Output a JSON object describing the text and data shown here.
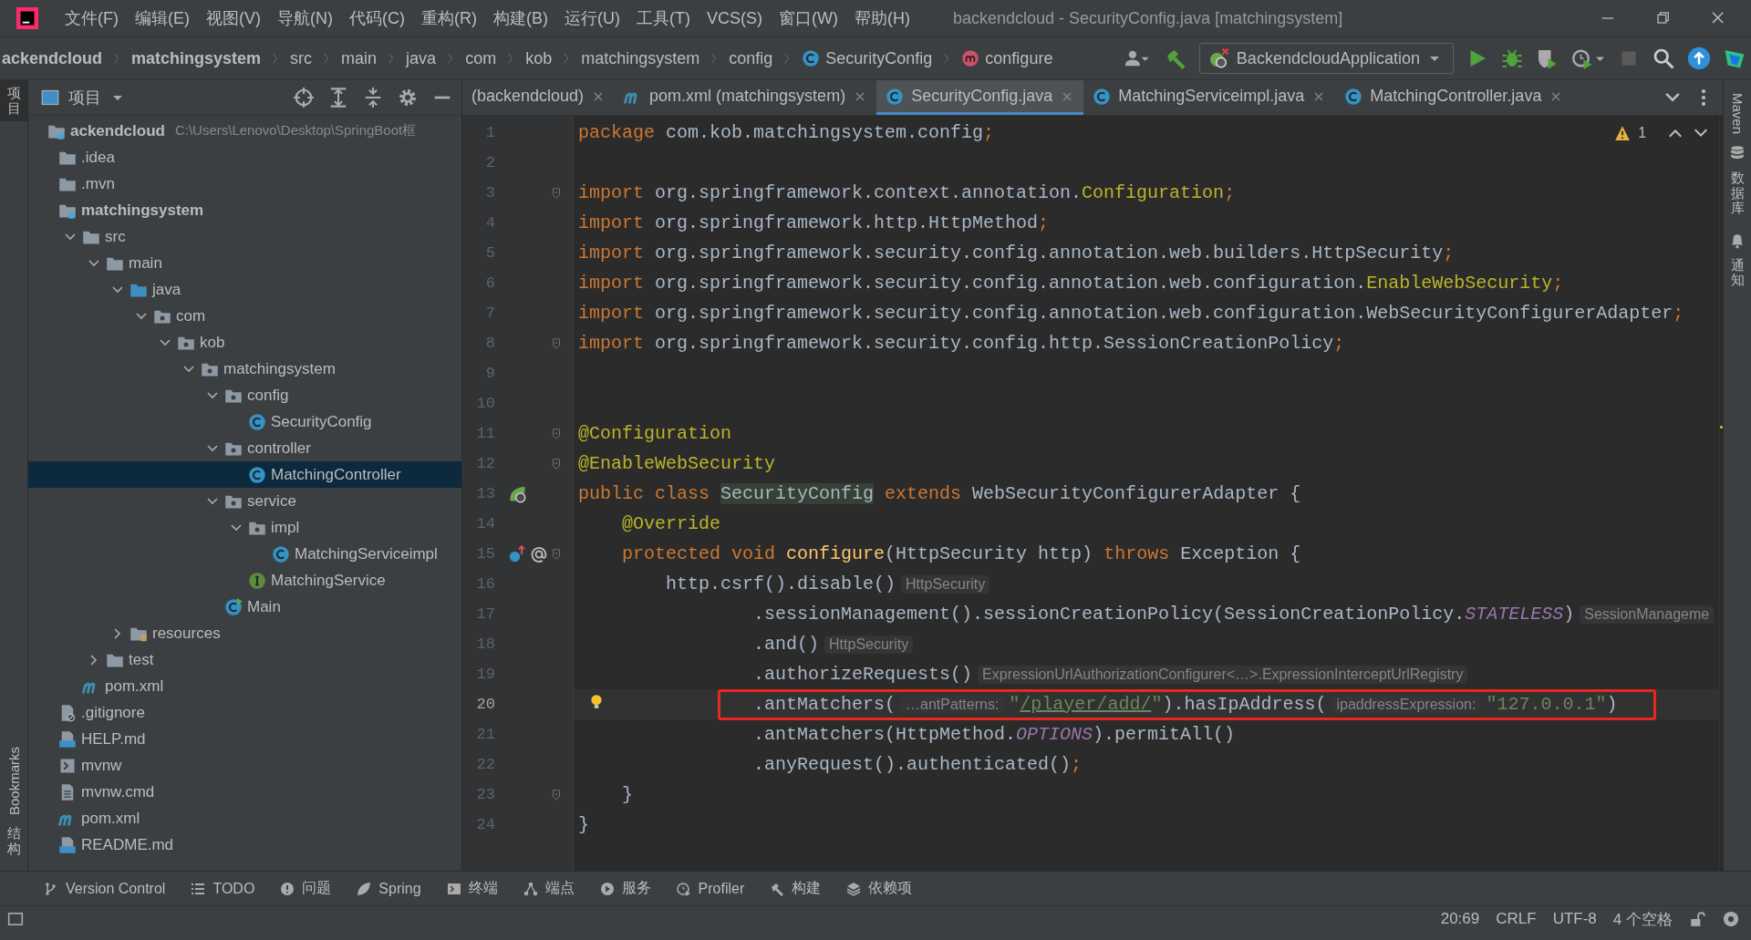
{
  "window": {
    "title": "backendcloud - SecurityConfig.java [matchingsystem]"
  },
  "menu": [
    "文件(F)",
    "编辑(E)",
    "视图(V)",
    "导航(N)",
    "代码(C)",
    "重构(R)",
    "构建(B)",
    "运行(U)",
    "工具(T)",
    "VCS(S)",
    "窗口(W)",
    "帮助(H)"
  ],
  "breadcrumbs": [
    {
      "label": "ackendcloud",
      "kind": "module"
    },
    {
      "label": "matchingsystem",
      "kind": "module"
    },
    {
      "label": "src",
      "kind": "folder"
    },
    {
      "label": "main",
      "kind": "folder"
    },
    {
      "label": "java",
      "kind": "folder"
    },
    {
      "label": "com",
      "kind": "folder"
    },
    {
      "label": "kob",
      "kind": "folder"
    },
    {
      "label": "matchingsystem",
      "kind": "folder"
    },
    {
      "label": "config",
      "kind": "folder"
    },
    {
      "label": "SecurityConfig",
      "kind": "class"
    },
    {
      "label": "configure",
      "kind": "method"
    }
  ],
  "run_config": "BackendcloudApplication",
  "left_stripe": [
    {
      "label": "项目",
      "kind": "stacked",
      "selected": true
    },
    {
      "label": "Bookmarks",
      "kind": "rotated",
      "selected": false
    },
    {
      "label": "结构",
      "kind": "stacked",
      "selected": false
    }
  ],
  "right_stripe": [
    {
      "label": "Maven",
      "kind": "rotated"
    },
    {
      "label": "数据库",
      "kind": "stacked"
    },
    {
      "label": "通知",
      "kind": "stacked"
    }
  ],
  "project_panel": {
    "title": "项目"
  },
  "tree": {
    "items": [
      {
        "label": "ackendcloud",
        "kind": "module",
        "hint": "C:\\Users\\Lenovo\\Desktop\\SpringBoot框",
        "selected": false,
        "children": [
          {
            "label": ".idea",
            "kind": "folder",
            "selected": false
          },
          {
            "label": ".mvn",
            "kind": "folder",
            "selected": false
          },
          {
            "label": "matchingsystem",
            "kind": "module",
            "selected": false,
            "children": [
              {
                "label": "src",
                "kind": "folder",
                "expanded": true,
                "selected": false,
                "children": [
                  {
                    "label": "main",
                    "kind": "folder",
                    "expanded": true,
                    "selected": false,
                    "children": [
                      {
                        "label": "java",
                        "kind": "source",
                        "expanded": true,
                        "selected": false,
                        "children": [
                          {
                            "label": "com",
                            "kind": "package",
                            "expanded": true,
                            "selected": false,
                            "children": [
                              {
                                "label": "kob",
                                "kind": "package",
                                "expanded": true,
                                "selected": false,
                                "children": [
                                  {
                                    "label": "matchingsystem",
                                    "kind": "package",
                                    "expanded": true,
                                    "selected": false,
                                    "children": [
                                      {
                                        "label": "config",
                                        "kind": "package",
                                        "expanded": true,
                                        "selected": false,
                                        "children": [
                                          {
                                            "label": "SecurityConfig",
                                            "kind": "class",
                                            "selected": false
                                          }
                                        ]
                                      },
                                      {
                                        "label": "controller",
                                        "kind": "package",
                                        "expanded": true,
                                        "selected": false,
                                        "children": [
                                          {
                                            "label": "MatchingController",
                                            "kind": "class",
                                            "selected": true
                                          }
                                        ]
                                      },
                                      {
                                        "label": "service",
                                        "kind": "package",
                                        "expanded": true,
                                        "selected": false,
                                        "children": [
                                          {
                                            "label": "impl",
                                            "kind": "package",
                                            "expanded": true,
                                            "selected": false,
                                            "children": [
                                              {
                                                "label": "MatchingServiceimpl",
                                                "kind": "class",
                                                "selected": false
                                              }
                                            ]
                                          },
                                          {
                                            "label": "MatchingService",
                                            "kind": "interface",
                                            "selected": false
                                          }
                                        ]
                                      },
                                      {
                                        "label": "Main",
                                        "kind": "main",
                                        "selected": false
                                      }
                                    ]
                                  }
                                ]
                              }
                            ]
                          }
                        ]
                      },
                      {
                        "label": "resources",
                        "kind": "resources",
                        "expanded": false,
                        "selected": false
                      }
                    ]
                  },
                  {
                    "label": "test",
                    "kind": "folder",
                    "expanded": false,
                    "selected": false
                  }
                ]
              },
              {
                "label": "pom.xml",
                "kind": "maven",
                "selected": false
              }
            ]
          },
          {
            "label": ".gitignore",
            "kind": "gitignore",
            "selected": false
          },
          {
            "label": "HELP.md",
            "kind": "markdown",
            "selected": false
          },
          {
            "label": "mvnw",
            "kind": "terminal",
            "selected": false
          },
          {
            "label": "mvnw.cmd",
            "kind": "file",
            "selected": false
          },
          {
            "label": "pom.xml",
            "kind": "maven",
            "selected": false
          },
          {
            "label": "README.md",
            "kind": "markdown",
            "selected": false
          }
        ]
      }
    ]
  },
  "tabs": [
    {
      "label": "(backendcloud)",
      "kind": "none",
      "selected": false
    },
    {
      "label": "pom.xml (matchingsystem)",
      "kind": "maven",
      "selected": false
    },
    {
      "label": "SecurityConfig.java",
      "kind": "class",
      "selected": true
    },
    {
      "label": "MatchingServiceimpl.java",
      "kind": "class",
      "selected": false
    },
    {
      "label": "MatchingController.java",
      "kind": "class",
      "selected": false
    }
  ],
  "warnings": "1",
  "code": {
    "lines": [
      {
        "number": "1",
        "segments": [
          {
            "kind": "keyword",
            "text": "package"
          },
          {
            "kind": "plain",
            "text": " com.kob.matchingsystem.config"
          },
          {
            "kind": "keyword",
            "text": ";"
          }
        ]
      },
      {
        "number": "2"
      },
      {
        "number": "3",
        "fold": true,
        "segments": [
          {
            "kind": "keyword",
            "text": "import"
          },
          {
            "kind": "plain",
            "text": " org.springframework.context.annotation."
          },
          {
            "kind": "annotation",
            "text": "Configuration"
          },
          {
            "kind": "keyword",
            "text": ";"
          }
        ]
      },
      {
        "number": "4",
        "segments": [
          {
            "kind": "keyword",
            "text": "import"
          },
          {
            "kind": "plain",
            "text": " org.springframework.http.HttpMethod"
          },
          {
            "kind": "keyword",
            "text": ";"
          }
        ]
      },
      {
        "number": "5",
        "segments": [
          {
            "kind": "keyword",
            "text": "import"
          },
          {
            "kind": "plain",
            "text": " org.springframework.security.config.annotation.web.builders.HttpSecurity"
          },
          {
            "kind": "keyword",
            "text": ";"
          }
        ]
      },
      {
        "number": "6",
        "segments": [
          {
            "kind": "keyword",
            "text": "import"
          },
          {
            "kind": "plain",
            "text": " org.springframework.security.config.annotation.web.configuration."
          },
          {
            "kind": "annotation",
            "text": "EnableWebSecurity"
          },
          {
            "kind": "keyword",
            "text": ";"
          }
        ]
      },
      {
        "number": "7",
        "segments": [
          {
            "kind": "keyword",
            "text": "import"
          },
          {
            "kind": "plain",
            "text": " org.springframework.security.config.annotation.web.configuration.WebSecurityConfigurerAdapter"
          },
          {
            "kind": "keyword",
            "text": ";"
          }
        ]
      },
      {
        "number": "8",
        "fold": true,
        "segments": [
          {
            "kind": "keyword",
            "text": "import"
          },
          {
            "kind": "plain",
            "text": " org.springframework.security.config.http.SessionCreationPolicy"
          },
          {
            "kind": "keyword",
            "text": ";"
          }
        ]
      },
      {
        "number": "9"
      },
      {
        "number": "10"
      },
      {
        "number": "11",
        "fold": true,
        "segments": [
          {
            "kind": "annotation",
            "text": "@Configuration"
          }
        ]
      },
      {
        "number": "12",
        "fold": true,
        "segments": [
          {
            "kind": "annotation",
            "text": "@EnableWebSecurity"
          }
        ]
      },
      {
        "number": "13",
        "markers": [
          {
            "kind": "bean"
          }
        ],
        "segments": [
          {
            "kind": "keyword",
            "text": "public class "
          },
          {
            "kind": "usage",
            "text": "SecurityConfig"
          },
          {
            "kind": "keyword",
            "text": " extends "
          },
          {
            "kind": "plain",
            "text": "WebSecurityConfigurerAdapter {"
          }
        ]
      },
      {
        "number": "14",
        "segments": [
          {
            "kind": "annotation",
            "text": "    @Override"
          }
        ]
      },
      {
        "number": "15",
        "fold": true,
        "markers": [
          {
            "kind": "override"
          },
          {
            "kind": "at"
          }
        ],
        "segments": [
          {
            "kind": "keyword",
            "text": "    protected void "
          },
          {
            "kind": "method",
            "text": "configure"
          },
          {
            "kind": "plain",
            "text": "(HttpSecurity http) "
          },
          {
            "kind": "keyword",
            "text": "throws "
          },
          {
            "kind": "plain",
            "text": "Exception {"
          }
        ]
      },
      {
        "number": "16",
        "segments": [
          {
            "kind": "plain",
            "text": "        http.csrf().disable()"
          },
          {
            "kind": "hint",
            "text": "HttpSecurity"
          }
        ]
      },
      {
        "number": "17",
        "segments": [
          {
            "kind": "plain",
            "text": "                .sessionManagement().sessionCreationPolicy(SessionCreationPolicy."
          },
          {
            "kind": "static",
            "text": "STATELESS"
          },
          {
            "kind": "plain",
            "text": ")"
          },
          {
            "kind": "hint",
            "text": "SessionManageme"
          }
        ]
      },
      {
        "number": "18",
        "segments": [
          {
            "kind": "plain",
            "text": "                .and()"
          },
          {
            "kind": "hint",
            "text": "HttpSecurity"
          }
        ]
      },
      {
        "number": "19",
        "segments": [
          {
            "kind": "plain",
            "text": "                .authorizeRequests()"
          },
          {
            "kind": "hint",
            "text": "ExpressionUrlAuthorizationConfigurer<…>.ExpressionInterceptUrlRegistry"
          }
        ]
      },
      {
        "number": "20",
        "current": true,
        "highlighted": true,
        "intention": true,
        "segments": [
          {
            "kind": "plain",
            "text": "                .antMatchers("
          },
          {
            "kind": "hint",
            "text": "…antPatterns:"
          },
          {
            "kind": "string",
            "text": "\""
          },
          {
            "kind": "link",
            "text": "/player/add/"
          },
          {
            "kind": "string",
            "text": "\""
          },
          {
            "kind": "plain",
            "text": ").hasIpAddress("
          },
          {
            "kind": "hint",
            "text": "ipaddressExpression:"
          },
          {
            "kind": "string",
            "text": "\"127.0.0.1\""
          },
          {
            "kind": "plain",
            "text": ")"
          }
        ]
      },
      {
        "number": "21",
        "segments": [
          {
            "kind": "plain",
            "text": "                .antMatchers(HttpMethod."
          },
          {
            "kind": "static",
            "text": "OPTIONS"
          },
          {
            "kind": "plain",
            "text": ").permitAll()"
          }
        ]
      },
      {
        "number": "22",
        "segments": [
          {
            "kind": "plain",
            "text": "                .anyRequest().authenticated()"
          },
          {
            "kind": "keyword",
            "text": ";"
          }
        ]
      },
      {
        "number": "23",
        "fold": true,
        "segments": [
          {
            "kind": "plain",
            "text": "    }"
          }
        ]
      },
      {
        "number": "24",
        "segments": [
          {
            "kind": "plain",
            "text": "}"
          }
        ]
      }
    ]
  },
  "tool_windows": [
    {
      "label": "Version Control",
      "kind": "branch"
    },
    {
      "label": "TODO",
      "kind": "list"
    },
    {
      "label": "问题",
      "kind": "info"
    },
    {
      "label": "Spring",
      "kind": "leaf"
    },
    {
      "label": "终端",
      "kind": "terminal"
    },
    {
      "label": "端点",
      "kind": "nodes"
    },
    {
      "label": "服务",
      "kind": "play"
    },
    {
      "label": "Profiler",
      "kind": "gauge"
    },
    {
      "label": "构建",
      "kind": "hammer"
    },
    {
      "label": "依赖项",
      "kind": "layers"
    }
  ],
  "status_bar": [
    "20:69",
    "CRLF",
    "UTF-8",
    "4 个空格"
  ]
}
